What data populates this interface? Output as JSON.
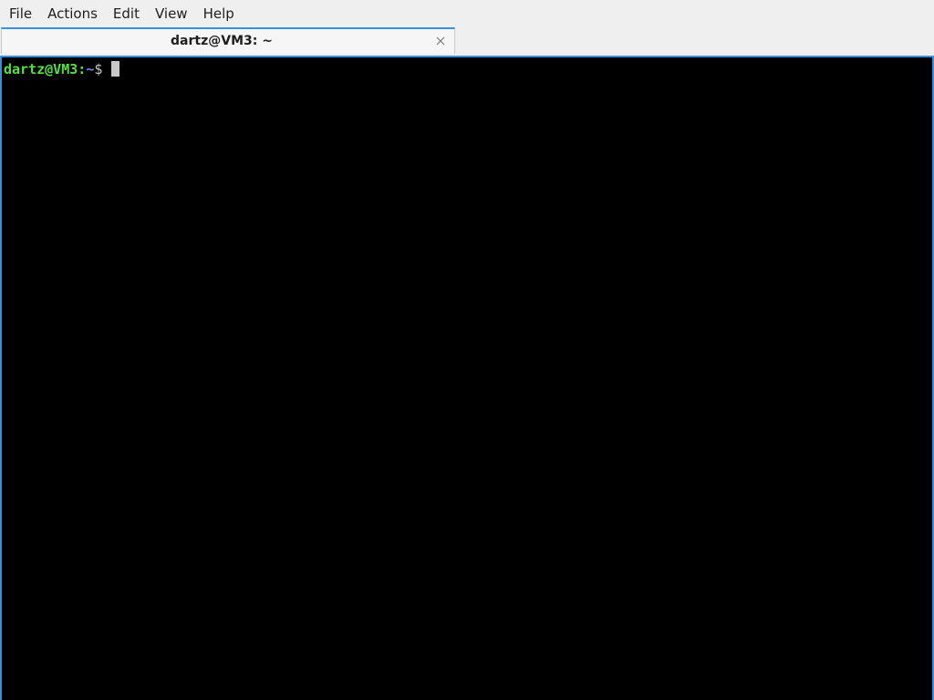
{
  "menubar": {
    "items": [
      {
        "label": "File"
      },
      {
        "label": "Actions"
      },
      {
        "label": "Edit"
      },
      {
        "label": "View"
      },
      {
        "label": "Help"
      }
    ]
  },
  "tabs": [
    {
      "title": "dartz@VM3: ~",
      "active": true,
      "close_icon": "close-icon"
    }
  ],
  "terminal": {
    "prompt_user_host": "dartz@VM3:",
    "prompt_path": "~",
    "prompt_sign": "$",
    "input": "",
    "colors": {
      "background": "#000000",
      "user_host": "#55e043",
      "path": "#6d8bdf",
      "text": "#c8c8c8",
      "focus_border": "#3a8fd9"
    }
  }
}
